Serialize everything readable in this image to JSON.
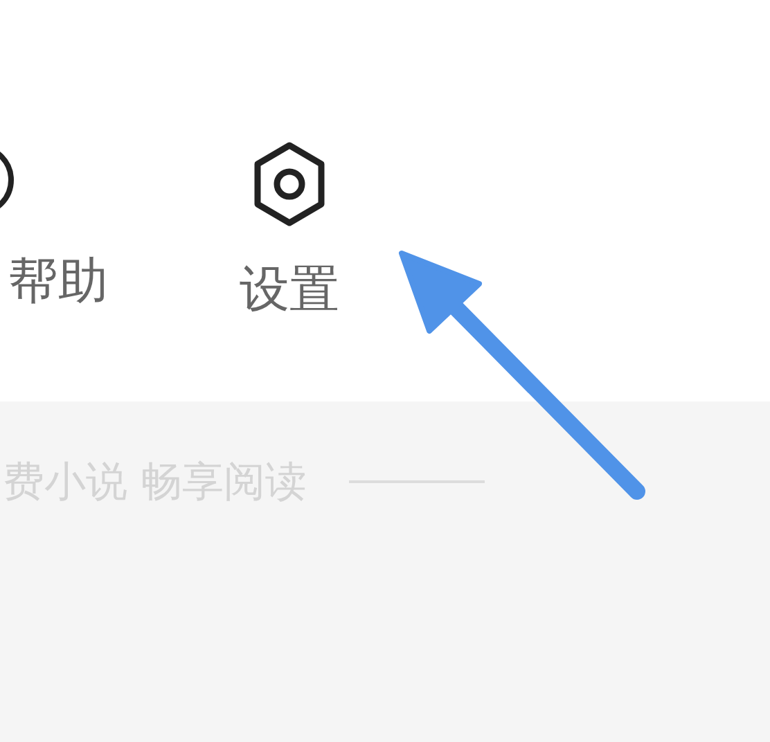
{
  "menu_items": [
    {
      "kind": "help",
      "label": "帮助"
    },
    {
      "kind": "settings",
      "label": "设置"
    }
  ],
  "footer": {
    "slogan": "费小说 畅享阅读"
  }
}
